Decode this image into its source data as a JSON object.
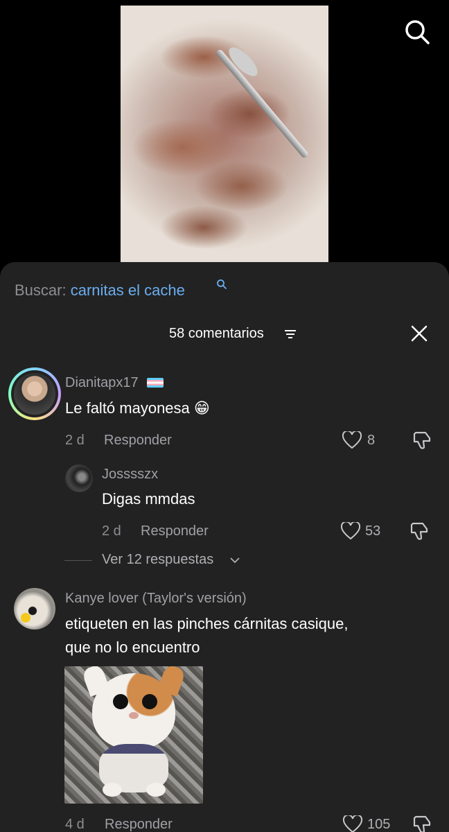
{
  "video": {
    "description_icon": "food-video-thumbnail"
  },
  "search": {
    "prefix": "Buscar:",
    "term": "carnitas el cache"
  },
  "header": {
    "count_label": "58 comentarios"
  },
  "comments": [
    {
      "user": "Dianitapx17",
      "text": "Le faltó mayonesa 😁",
      "time": "2 d",
      "reply": "Responder",
      "likes": "8"
    },
    {
      "user": "Josssszx",
      "text": "Digas mmdas",
      "time": "2 d",
      "reply": "Responder",
      "likes": "53"
    },
    {
      "user": "Kanye lover (Taylor's versión)",
      "text_line1": "etiqueten en las pinches cárnitas casique,",
      "text_line2": "que no lo encuentro",
      "time": "4 d",
      "reply": "Responder",
      "likes": "105"
    }
  ],
  "view_replies": "Ver 12 respuestas",
  "colors": {
    "accent": "#6aaef0",
    "sheet": "#222222",
    "text_muted": "#8e8e93"
  }
}
